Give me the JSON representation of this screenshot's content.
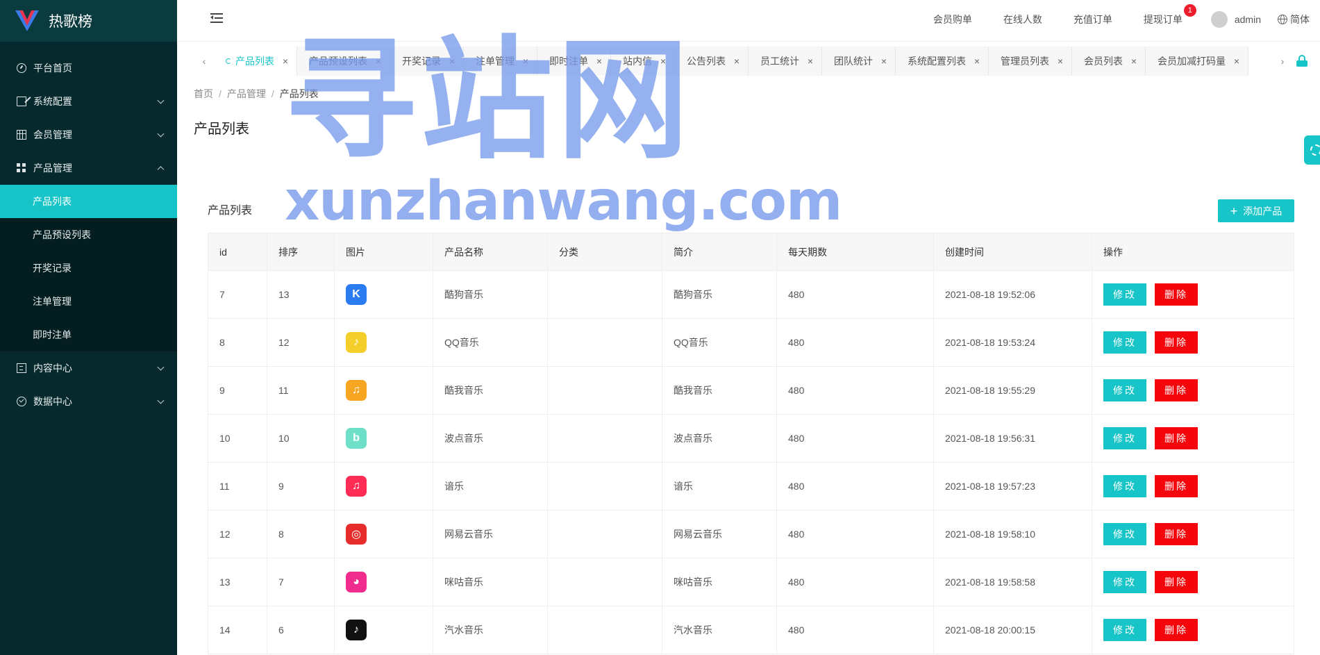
{
  "app": {
    "name": "热歌榜"
  },
  "sidebar": {
    "items": [
      {
        "label": "平台首页",
        "icon": "dashboard-icon"
      },
      {
        "label": "系统配置",
        "icon": "edit-icon"
      },
      {
        "label": "会员管理",
        "icon": "table-icon"
      },
      {
        "label": "产品管理",
        "icon": "grid-icon"
      },
      {
        "label": "内容中心",
        "icon": "document-icon"
      },
      {
        "label": "数据中心",
        "icon": "check-circle-icon"
      }
    ],
    "submenu": [
      "产品列表",
      "产品预设列表",
      "开奖记录",
      "注单管理",
      "即时注单"
    ]
  },
  "topbar": {
    "links": [
      "会员购单",
      "在线人数",
      "充值订单",
      "提现订单"
    ],
    "withdraw_badge": "1",
    "user": "admin",
    "lang": "简体"
  },
  "tabs": [
    "产品列表",
    "产品预设列表",
    "开奖记录",
    "注单管理",
    "即时注单",
    "站内信",
    "公告列表",
    "员工统计",
    "团队统计",
    "系统配置列表",
    "管理员列表",
    "会员列表",
    "会员加减打码量"
  ],
  "breadcrumb": [
    "首页",
    "产品管理",
    "产品列表"
  ],
  "page": {
    "title": "产品列表",
    "card_title": "产品列表",
    "add_button": "添加产品"
  },
  "table": {
    "headers": [
      "id",
      "排序",
      "图片",
      "产品名称",
      "分类",
      "简介",
      "每天期数",
      "创建时间",
      "操作"
    ],
    "edit_label": "修改",
    "delete_label": "删除",
    "rows": [
      {
        "id": "7",
        "sort": "13",
        "name": "酷狗音乐",
        "category": "",
        "intro": "酷狗音乐",
        "periods": "480",
        "created": "2021-08-18 19:52:06",
        "logo_color": "#2b7cf0",
        "logo_glyph": "K"
      },
      {
        "id": "8",
        "sort": "12",
        "name": "QQ音乐",
        "category": "",
        "intro": "QQ音乐",
        "periods": "480",
        "created": "2021-08-18 19:53:24",
        "logo_color": "#f4cf2b",
        "logo_glyph": "♪"
      },
      {
        "id": "9",
        "sort": "11",
        "name": "酷我音乐",
        "category": "",
        "intro": "酷我音乐",
        "periods": "480",
        "created": "2021-08-18 19:55:29",
        "logo_color": "#f7a623",
        "logo_glyph": "♫"
      },
      {
        "id": "10",
        "sort": "10",
        "name": "波点音乐",
        "category": "",
        "intro": "波点音乐",
        "periods": "480",
        "created": "2021-08-18 19:56:31",
        "logo_color": "#6ee0c8",
        "logo_glyph": "b"
      },
      {
        "id": "11",
        "sort": "9",
        "name": "谙乐",
        "category": "",
        "intro": "谙乐",
        "periods": "480",
        "created": "2021-08-18 19:57:23",
        "logo_color": "#ff2d55",
        "logo_glyph": "♫"
      },
      {
        "id": "12",
        "sort": "8",
        "name": "网易云音乐",
        "category": "",
        "intro": "网易云音乐",
        "periods": "480",
        "created": "2021-08-18 19:58:10",
        "logo_color": "#e72d2c",
        "logo_glyph": "◎"
      },
      {
        "id": "13",
        "sort": "7",
        "name": "咪咕音乐",
        "category": "",
        "intro": "咪咕音乐",
        "periods": "480",
        "created": "2021-08-18 19:58:58",
        "logo_color": "#f02d8e",
        "logo_glyph": "◕"
      },
      {
        "id": "14",
        "sort": "6",
        "name": "汽水音乐",
        "category": "",
        "intro": "汽水音乐",
        "periods": "480",
        "created": "2021-08-18 20:00:15",
        "logo_color": "#111111",
        "logo_glyph": "♪"
      }
    ]
  },
  "watermark": {
    "cn": "寻站网",
    "en": "xunzhanwang.com"
  },
  "colors": {
    "accent": "#17c5c8",
    "danger": "#f5060c",
    "sidebar": "#06292d"
  }
}
